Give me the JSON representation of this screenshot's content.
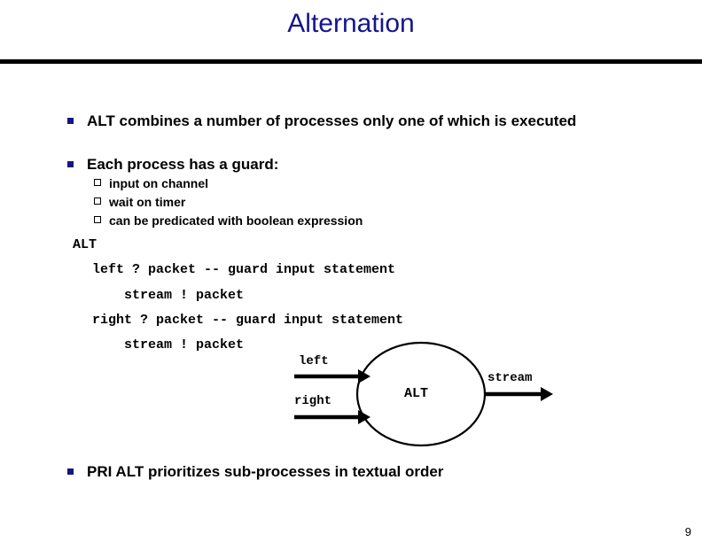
{
  "slide": {
    "title": "Alternation",
    "page_number": "9",
    "title_color": "#15158c",
    "bullet_marker_color": "#16167e",
    "rule_color": "#000000",
    "background_color": "#ffffff"
  },
  "bullets_level1": [
    {
      "marker": "filled-square-bullet",
      "text": "ALT combines a number of processes only one of which is executed"
    },
    {
      "marker": "filled-square-bullet",
      "text": "Each process has a guard:"
    },
    {
      "marker": "filled-square-bullet",
      "text": "PRI ALT prioritizes sub-processes in textual order"
    }
  ],
  "bullets_level2": [
    {
      "marker": "hollow-square-bullet",
      "text": "input on channel"
    },
    {
      "marker": "hollow-square-bullet",
      "text": "wait on timer"
    },
    {
      "marker": "hollow-square-bullet",
      "text": "can be predicated with boolean expression"
    }
  ],
  "code_block": {
    "lines": [
      "ALT",
      "left ? packet -- guard input statement",
      "stream ! packet",
      "right ? packet -- guard input statement",
      "stream ! packet"
    ]
  },
  "diagram": {
    "process_label": "ALT",
    "inputs": [
      {
        "label": "left"
      },
      {
        "label": "right"
      }
    ],
    "outputs": [
      {
        "label": "stream"
      }
    ]
  }
}
